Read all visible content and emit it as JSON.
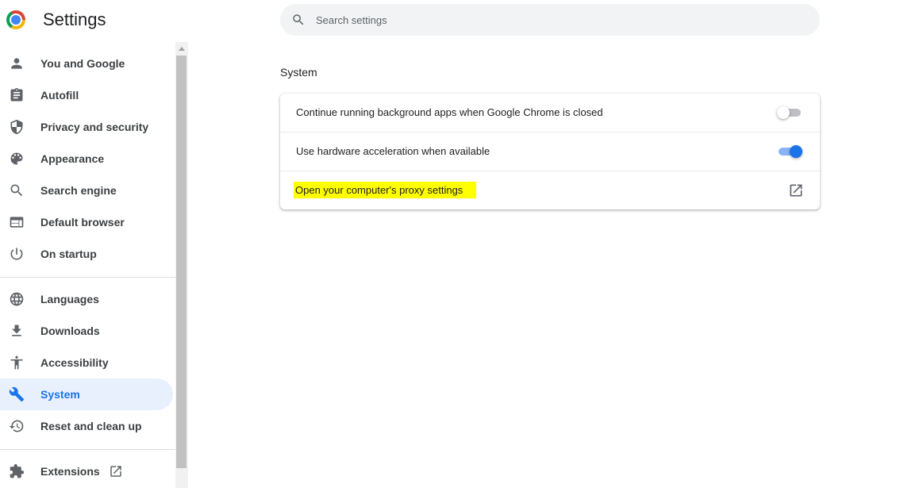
{
  "header": {
    "title": "Settings",
    "search_placeholder": "Search settings",
    "search_value": ""
  },
  "sidebar": {
    "items": [
      {
        "label": "You and Google",
        "icon": "person-icon",
        "active": false
      },
      {
        "label": "Autofill",
        "icon": "clipboard-icon",
        "active": false
      },
      {
        "label": "Privacy and security",
        "icon": "shield-icon",
        "active": false
      },
      {
        "label": "Appearance",
        "icon": "palette-icon",
        "active": false
      },
      {
        "label": "Search engine",
        "icon": "search-icon",
        "active": false
      },
      {
        "label": "Default browser",
        "icon": "browser-window-icon",
        "active": false
      },
      {
        "label": "On startup",
        "icon": "power-icon",
        "active": false
      },
      {
        "label": "Languages",
        "icon": "globe-icon",
        "active": false
      },
      {
        "label": "Downloads",
        "icon": "download-icon",
        "active": false
      },
      {
        "label": "Accessibility",
        "icon": "accessibility-icon",
        "active": false
      },
      {
        "label": "System",
        "icon": "wrench-icon",
        "active": true
      },
      {
        "label": "Reset and clean up",
        "icon": "restore-icon",
        "active": false
      },
      {
        "label": "Extensions",
        "icon": "puzzle-icon",
        "active": false
      }
    ]
  },
  "main": {
    "section_title": "System",
    "rows": [
      {
        "label": "Continue running background apps when Google Chrome is closed",
        "control": "toggle",
        "on": false
      },
      {
        "label": "Use hardware acceleration when available",
        "control": "toggle",
        "on": true
      },
      {
        "label": "Open your computer's proxy settings",
        "control": "external-link",
        "highlighted": true
      }
    ]
  },
  "colors": {
    "accent": "#1a73e8",
    "active_bg": "#e8f0fe",
    "highlight": "#ffff00",
    "icon": "#5f6368"
  }
}
